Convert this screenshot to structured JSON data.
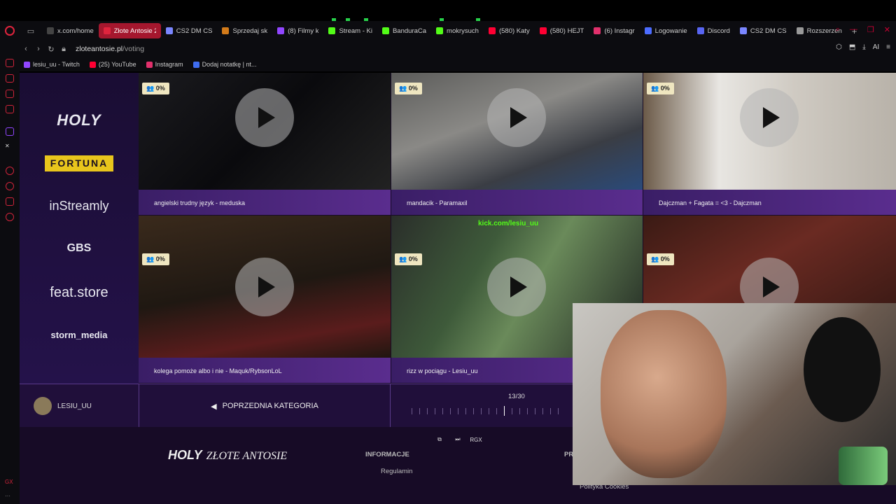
{
  "tabs": [
    {
      "label": "x.com/home",
      "color": "#444"
    },
    {
      "label": "Złote Antosie 2025",
      "color": "#e0243d",
      "active": true
    },
    {
      "label": "CS2 DM CS",
      "color": "#7a86ff"
    },
    {
      "label": "Sprzedaj sk",
      "color": "#d37b1a"
    },
    {
      "label": "(8) Filmy k",
      "color": "#9146ff"
    },
    {
      "label": "Stream - Ki",
      "color": "#53fc18"
    },
    {
      "label": "BanduraCa",
      "color": "#53fc18"
    },
    {
      "label": "mokrysuch",
      "color": "#53fc18"
    },
    {
      "label": "(580) Katy",
      "color": "#ff0033"
    },
    {
      "label": "(580) HEJT",
      "color": "#ff0033"
    },
    {
      "label": "(6) Instagr",
      "color": "#e1306c"
    },
    {
      "label": "Logowanie",
      "color": "#4c6cff"
    },
    {
      "label": "Discord",
      "color": "#5865f2"
    },
    {
      "label": "CS2 DM CS",
      "color": "#7a86ff"
    },
    {
      "label": "Rozszerzen",
      "color": "#999"
    }
  ],
  "address": {
    "domain": "zloteantosie.pl",
    "path": "/voting"
  },
  "address_right": {
    "ai_label": "AI"
  },
  "bookmarks": [
    {
      "label": "lesiu_uu - Twitch",
      "color": "#9146ff"
    },
    {
      "label": "(25) YouTube",
      "color": "#ff0033"
    },
    {
      "label": "Instagram",
      "color": "#e1306c"
    },
    {
      "label": "Dodaj notatkę | nt...",
      "color": "#3f6df0"
    }
  ],
  "sponsors": {
    "holy": "HOLY",
    "fortuna": "FORTUNA",
    "instreamly": "inStreamly",
    "gbs": "GBS",
    "feat": "feat.store",
    "storm": "storm_media"
  },
  "videos": [
    {
      "title": "angielski trudny język - meduska",
      "percent": "0%"
    },
    {
      "title": "mandacik - Paramaxil",
      "percent": "0%"
    },
    {
      "title": "Dajczman + Fagata = <3 - Dajczman",
      "percent": "0%"
    },
    {
      "title": "kolega pomoże albo i nie - Maquk/RybsonLoL",
      "percent": "0%"
    },
    {
      "title": "rizz w pociągu - Lesiu_uu",
      "percent": "0%"
    },
    {
      "title": "",
      "percent": "0%"
    }
  ],
  "kick_overlay": "kick.com/lesiu_uu",
  "user": {
    "name": "LESIU_UU"
  },
  "navigation": {
    "prev_category": "POPRZEDNIA KATEGORIA",
    "counter": "13/30"
  },
  "footer": {
    "logo": "HOLY",
    "logo_sub": "ZŁOTE ANTOSIE",
    "info_heading": "INFORMACJE",
    "info_link": "Regulamin",
    "second_heading": "PR",
    "second_link": "Polityka Cookies",
    "mini_label": "RGX"
  },
  "sidebar_bottom": "GX"
}
